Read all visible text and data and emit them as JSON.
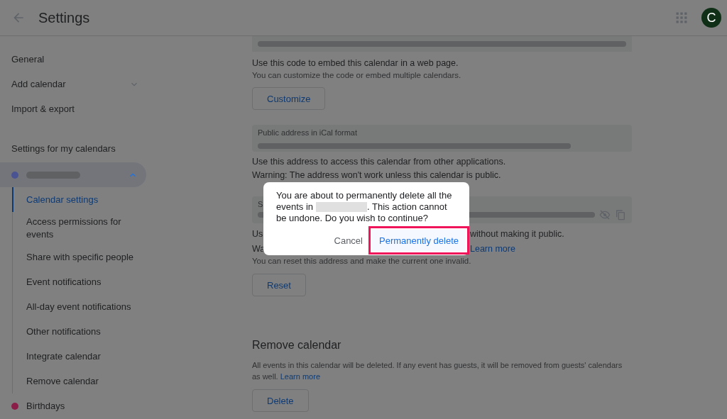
{
  "header": {
    "title": "Settings",
    "avatar": "C"
  },
  "sidebar": {
    "top_items": [
      {
        "label": "General",
        "kind": "plain"
      },
      {
        "label": "Add calendar",
        "kind": "expandable",
        "expanded": false
      },
      {
        "label": "Import & export",
        "kind": "plain"
      }
    ],
    "section_title": "Settings for my calendars",
    "calendars": [
      {
        "color": "#4a5492",
        "expanded": true,
        "selected": true,
        "children": [
          {
            "label": "Calendar settings",
            "selected": true
          },
          {
            "label": "Access permissions for events",
            "selected": false
          },
          {
            "label": "Share with specific people",
            "selected": false
          },
          {
            "label": "Event notifications",
            "selected": false
          },
          {
            "label": "All-day event notifications",
            "selected": false
          },
          {
            "label": "Other notifications",
            "selected": false
          },
          {
            "label": "Integrate calendar",
            "selected": false
          },
          {
            "label": "Remove calendar",
            "selected": false
          }
        ]
      },
      {
        "label": "Birthdays",
        "color": "#8a1e48",
        "selected": false
      }
    ]
  },
  "main": {
    "embed_help": "Use this code to embed this calendar in a web page.",
    "embed_note": "You can customize the code or embed multiple calendars.",
    "customize_button": "Customize",
    "ical_field": {
      "label": "Public address in iCal format"
    },
    "ical_help": "Use this address to access this calendar from other applications.",
    "ical_warning": "Warning: The address won't work unless this calendar is public.",
    "secret_field": {
      "label": "S"
    },
    "secret_help": [
      "Us",
      "without making it public."
    ],
    "secret_warning": {
      "text": "Wa",
      "link": "Learn more"
    },
    "secret_note": "You can reset this address and make the current one invalid.",
    "reset_button": "Reset",
    "remove_heading": "Remove calendar",
    "remove_text": "All events in this calendar will be deleted. If any event has guests, it will be removed from guests' calendars as well.",
    "remove_link": "Learn more",
    "delete_button": "Delete"
  },
  "dialog": {
    "message_lines": [
      [
        {
          "kind": "text",
          "text": "You are about to permanently delete all the"
        }
      ],
      [
        {
          "kind": "text",
          "text": "events in"
        },
        {
          "kind": "redacted"
        },
        {
          "kind": "text",
          "text": ". This action cannot"
        }
      ],
      [
        {
          "kind": "text",
          "text": "be undone. Do you wish to continue?"
        }
      ]
    ],
    "buttons": [
      {
        "label": "Cancel",
        "kind": "text",
        "highlighted": false
      },
      {
        "label": "Permanently delete",
        "kind": "primary",
        "highlighted": true
      }
    ]
  }
}
